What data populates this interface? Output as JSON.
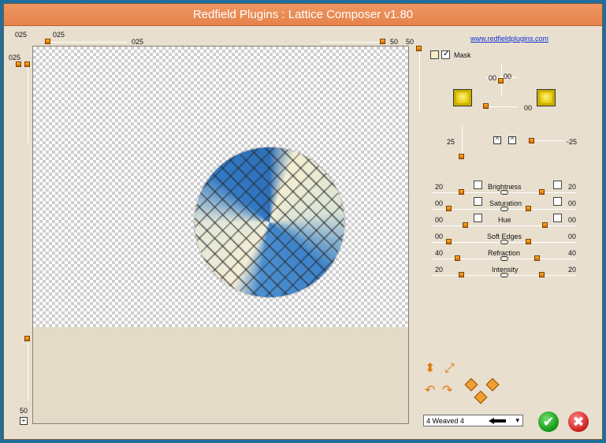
{
  "window": {
    "title": "Redfield Plugins : Lattice Composer v1.80"
  },
  "link": "www.redfieldplugins.com",
  "rulers": {
    "top_left_value": "025",
    "top_knob_value": "025",
    "top_mid_value": "025",
    "top_right_value_a": "50",
    "top_right_value_b": "50",
    "left_top_value": "025",
    "left_bottom_value": "50"
  },
  "mask": {
    "label": "Mask",
    "checked": true
  },
  "light": {
    "value_a": "00",
    "value_b": "00",
    "value_c": "00",
    "depth_value": "25",
    "tilt_value": "-25"
  },
  "adjustments": [
    {
      "label": "Brightness",
      "left": "20",
      "right": "20"
    },
    {
      "label": "Saturation",
      "left": "00",
      "right": "00"
    },
    {
      "label": "Hue",
      "left": "00",
      "right": "00"
    },
    {
      "label": "Soft Edges",
      "left": "00",
      "right": "00"
    },
    {
      "label": "Refraction",
      "left": "40",
      "right": "40"
    },
    {
      "label": "Intensity",
      "left": "20",
      "right": "20"
    }
  ],
  "preset": {
    "selected": "4 Weaved 4"
  },
  "buttons": {
    "ok": "✔",
    "cancel": "✖"
  },
  "colors": {
    "title_bar": "#e98a52",
    "accent": "#e07a10",
    "ok": "#1a9a1a",
    "cancel": "#d22222"
  }
}
